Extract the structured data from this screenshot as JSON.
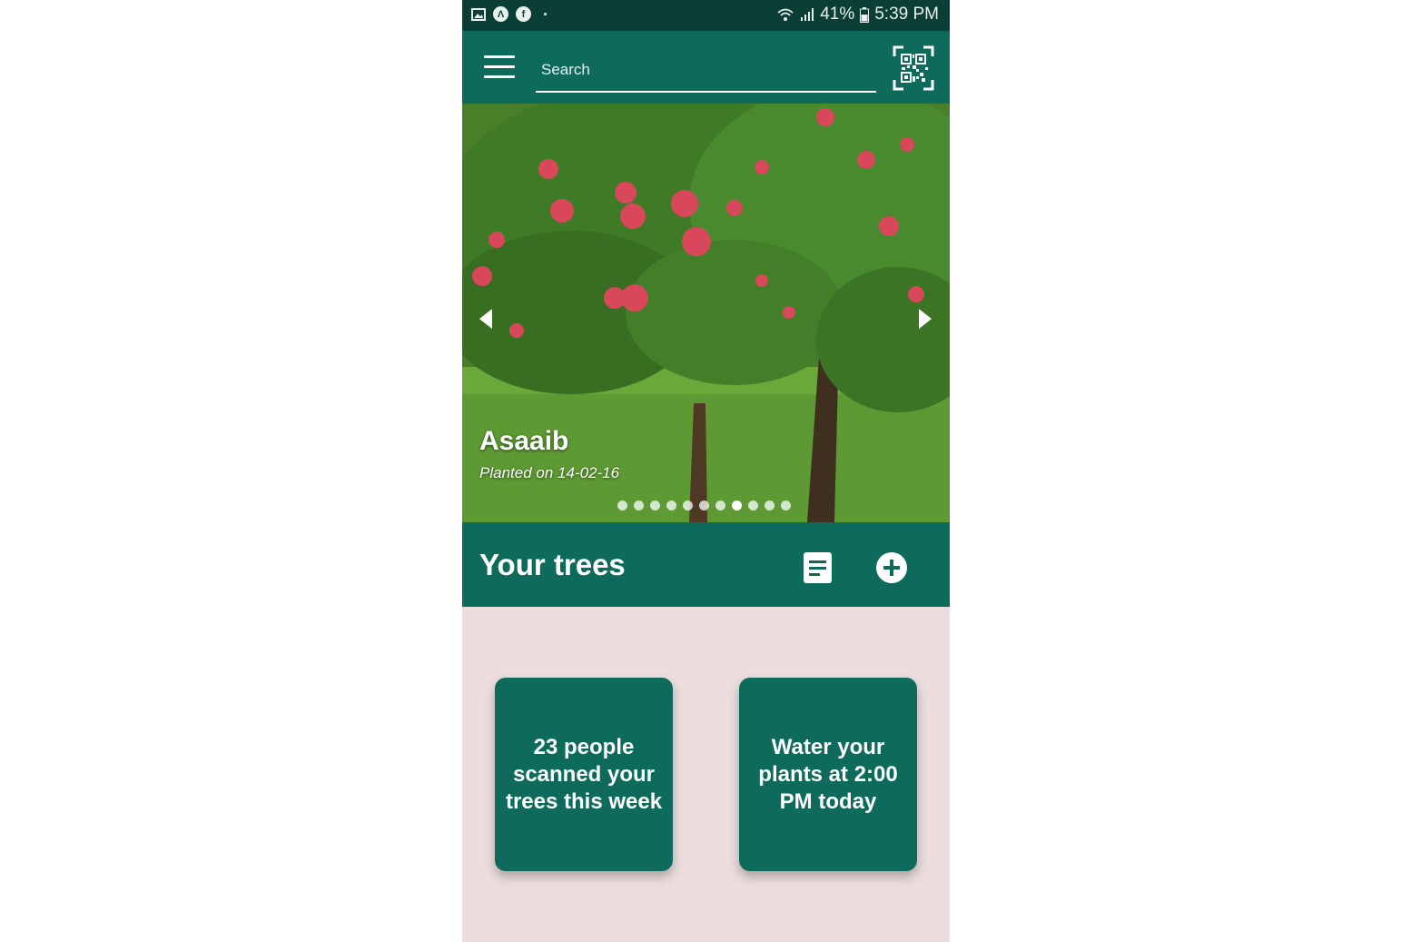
{
  "status_bar": {
    "battery": "41%",
    "time": "5:39 PM",
    "icons": [
      "image-icon",
      "a-icon",
      "facebook-icon",
      "wifi-icon",
      "signal-icon",
      "battery-icon"
    ]
  },
  "app_bar": {
    "search_placeholder": "Search",
    "icons": [
      "menu-icon",
      "qr-code-icon"
    ]
  },
  "carousel": {
    "tree_name": "Asaaib",
    "planted": "Planted on 14-02-16",
    "slide_count": 11,
    "active_slide_index": 7
  },
  "section": {
    "title": "Your trees"
  },
  "cards": {
    "scans": "23 people scanned your trees this week",
    "water": "Water your plants at 2:00 PM today"
  },
  "colors": {
    "primary": "#0e6b5c",
    "status_bar": "#0b3f36",
    "background": "#ecdede"
  }
}
